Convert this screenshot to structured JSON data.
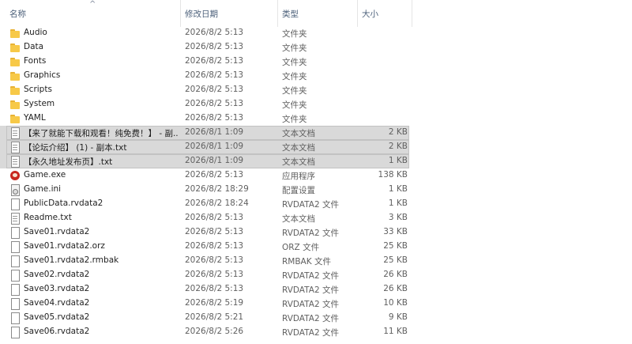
{
  "columns": {
    "name": "名称",
    "date": "修改日期",
    "type": "类型",
    "size": "大小",
    "sort_indicator": "^"
  },
  "files": [
    {
      "name": "Audio",
      "date": "2026/8/2 5:13",
      "type": "文件夹",
      "size": "",
      "icon": "folder-icon",
      "selected": false
    },
    {
      "name": "Data",
      "date": "2026/8/2 5:13",
      "type": "文件夹",
      "size": "",
      "icon": "folder-icon",
      "selected": false
    },
    {
      "name": "Fonts",
      "date": "2026/8/2 5:13",
      "type": "文件夹",
      "size": "",
      "icon": "folder-icon",
      "selected": false
    },
    {
      "name": "Graphics",
      "date": "2026/8/2 5:13",
      "type": "文件夹",
      "size": "",
      "icon": "folder-icon",
      "selected": false
    },
    {
      "name": "Scripts",
      "date": "2026/8/2 5:13",
      "type": "文件夹",
      "size": "",
      "icon": "folder-icon",
      "selected": false
    },
    {
      "name": "System",
      "date": "2026/8/2 5:13",
      "type": "文件夹",
      "size": "",
      "icon": "folder-icon",
      "selected": false
    },
    {
      "name": "YAML",
      "date": "2026/8/2 5:13",
      "type": "文件夹",
      "size": "",
      "icon": "folder-icon",
      "selected": false
    },
    {
      "name": "【来了就能下载和观看！纯免费！】 - 副...",
      "date": "2026/8/1 1:09",
      "type": "文本文档",
      "size": "2 KB",
      "icon": "text-file-icon",
      "selected": true
    },
    {
      "name": "【论坛介绍】 (1) - 副本.txt",
      "date": "2026/8/1 1:09",
      "type": "文本文档",
      "size": "2 KB",
      "icon": "text-file-icon",
      "selected": true
    },
    {
      "name": "【永久地址发布页】.txt",
      "date": "2026/8/1 1:09",
      "type": "文本文档",
      "size": "1 KB",
      "icon": "text-file-icon",
      "selected": true
    },
    {
      "name": "Game.exe",
      "date": "2026/8/2 5:13",
      "type": "应用程序",
      "size": "138 KB",
      "icon": "game-exe-icon",
      "selected": false
    },
    {
      "name": "Game.ini",
      "date": "2026/8/2 18:29",
      "type": "配置设置",
      "size": "1 KB",
      "icon": "settings-file-icon",
      "selected": false
    },
    {
      "name": "PublicData.rvdata2",
      "date": "2026/8/2 18:24",
      "type": "RVDATA2 文件",
      "size": "1 KB",
      "icon": "file-icon",
      "selected": false
    },
    {
      "name": "Readme.txt",
      "date": "2026/8/2 5:13",
      "type": "文本文档",
      "size": "3 KB",
      "icon": "text-file-icon",
      "selected": false
    },
    {
      "name": "Save01.rvdata2",
      "date": "2026/8/2 5:13",
      "type": "RVDATA2 文件",
      "size": "33 KB",
      "icon": "file-icon",
      "selected": false
    },
    {
      "name": "Save01.rvdata2.orz",
      "date": "2026/8/2 5:13",
      "type": "ORZ 文件",
      "size": "25 KB",
      "icon": "file-icon",
      "selected": false
    },
    {
      "name": "Save01.rvdata2.rmbak",
      "date": "2026/8/2 5:13",
      "type": "RMBAK 文件",
      "size": "25 KB",
      "icon": "file-icon",
      "selected": false
    },
    {
      "name": "Save02.rvdata2",
      "date": "2026/8/2 5:13",
      "type": "RVDATA2 文件",
      "size": "26 KB",
      "icon": "file-icon",
      "selected": false
    },
    {
      "name": "Save03.rvdata2",
      "date": "2026/8/2 5:13",
      "type": "RVDATA2 文件",
      "size": "26 KB",
      "icon": "file-icon",
      "selected": false
    },
    {
      "name": "Save04.rvdata2",
      "date": "2026/8/2 5:19",
      "type": "RVDATA2 文件",
      "size": "10 KB",
      "icon": "file-icon",
      "selected": false
    },
    {
      "name": "Save05.rvdata2",
      "date": "2026/8/2 5:21",
      "type": "RVDATA2 文件",
      "size": "9 KB",
      "icon": "file-icon",
      "selected": false
    },
    {
      "name": "Save06.rvdata2",
      "date": "2026/8/2 5:26",
      "type": "RVDATA2 文件",
      "size": "11 KB",
      "icon": "file-icon",
      "selected": false
    }
  ]
}
